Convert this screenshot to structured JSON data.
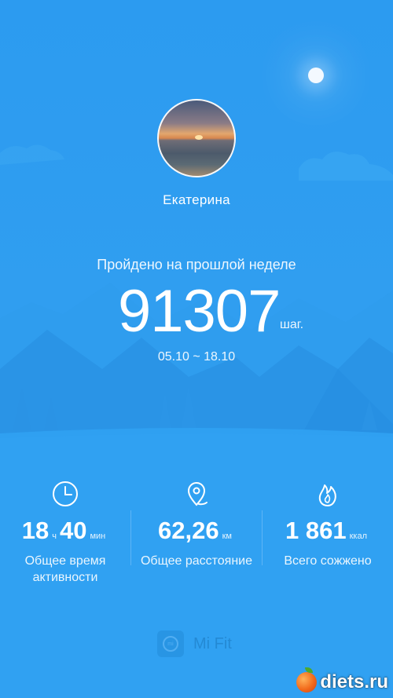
{
  "user": {
    "name": "Екатерина"
  },
  "summary": {
    "label": "Пройдено на прошлой неделе",
    "steps": "91307",
    "steps_unit": "шаг.",
    "date_range": "05.10 ~ 18.10"
  },
  "stats": {
    "activity": {
      "hours": "18",
      "hours_unit": "ч",
      "minutes": "40",
      "minutes_unit": "мин",
      "caption_line1": "Общее время",
      "caption_line2": "активности",
      "icon": "clock-icon"
    },
    "distance": {
      "value": "62,26",
      "unit": "км",
      "caption": "Общее расстояние",
      "icon": "location-pin-icon"
    },
    "calories": {
      "value": "1 861",
      "unit": "ккал",
      "caption": "Всего сожжено",
      "icon": "flame-icon"
    }
  },
  "brand": {
    "name": "Mi Fit",
    "logo_text": "mi"
  },
  "watermark": {
    "text": "diets.ru"
  },
  "colors": {
    "background": "#2e9ff1",
    "hills_dark": "#2a93e5",
    "hills_light": "#42a8f2"
  }
}
